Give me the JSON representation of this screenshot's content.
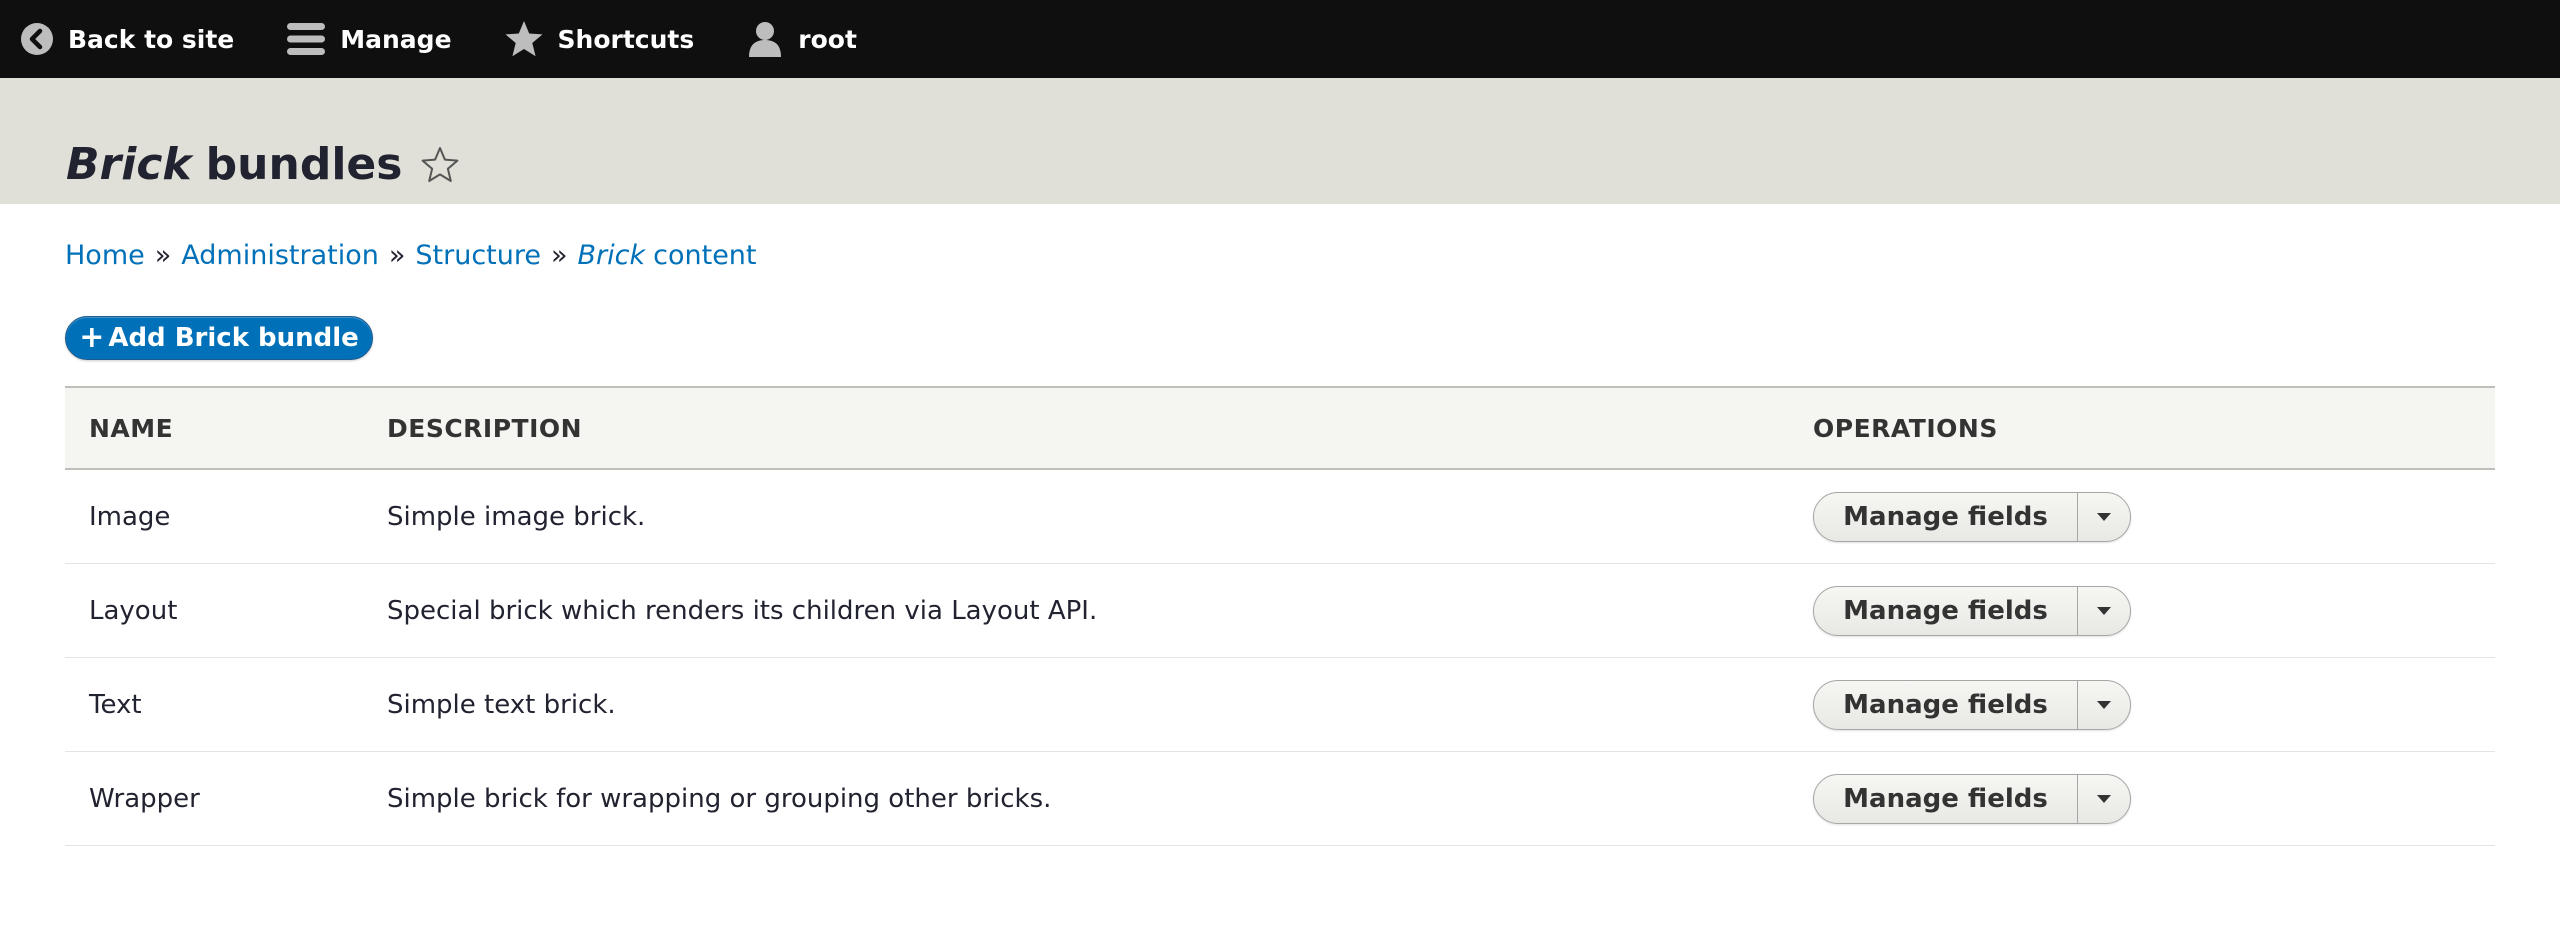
{
  "toolbar": {
    "back_label": "Back to site",
    "manage_label": "Manage",
    "shortcuts_label": "Shortcuts",
    "user_label": "root"
  },
  "page": {
    "title_em": "Brick",
    "title_rest": "bundles"
  },
  "breadcrumb": {
    "items": [
      {
        "label": "Home"
      },
      {
        "label": "Administration"
      },
      {
        "label": "Structure"
      },
      {
        "label_em": "Brick",
        "label_rest": "content"
      }
    ],
    "separator": "»"
  },
  "add_button": {
    "plus": "+",
    "label": "Add Brick bundle"
  },
  "table": {
    "headers": {
      "name": "NAME",
      "description": "DESCRIPTION",
      "operations": "OPERATIONS"
    },
    "rows": [
      {
        "name": "Image",
        "description": "Simple image brick.",
        "operation": "Manage fields"
      },
      {
        "name": "Layout",
        "description": "Special brick which renders its children via Layout API.",
        "operation": "Manage fields"
      },
      {
        "name": "Text",
        "description": "Simple text brick.",
        "operation": "Manage fields"
      },
      {
        "name": "Wrapper",
        "description": "Simple brick for wrapping or grouping other bricks.",
        "operation": "Manage fields"
      }
    ]
  },
  "icons": {
    "back": "chevron-left-circle-icon",
    "manage": "hamburger-icon",
    "shortcuts": "star-icon",
    "user": "user-icon",
    "title_star": "star-outline-icon",
    "dropdown": "caret-down-icon"
  },
  "colors": {
    "toolbar_bg": "#0f0f0f",
    "header_bg": "#e0e0d8",
    "link": "#0071b8",
    "primary_button": "#0071b8"
  }
}
